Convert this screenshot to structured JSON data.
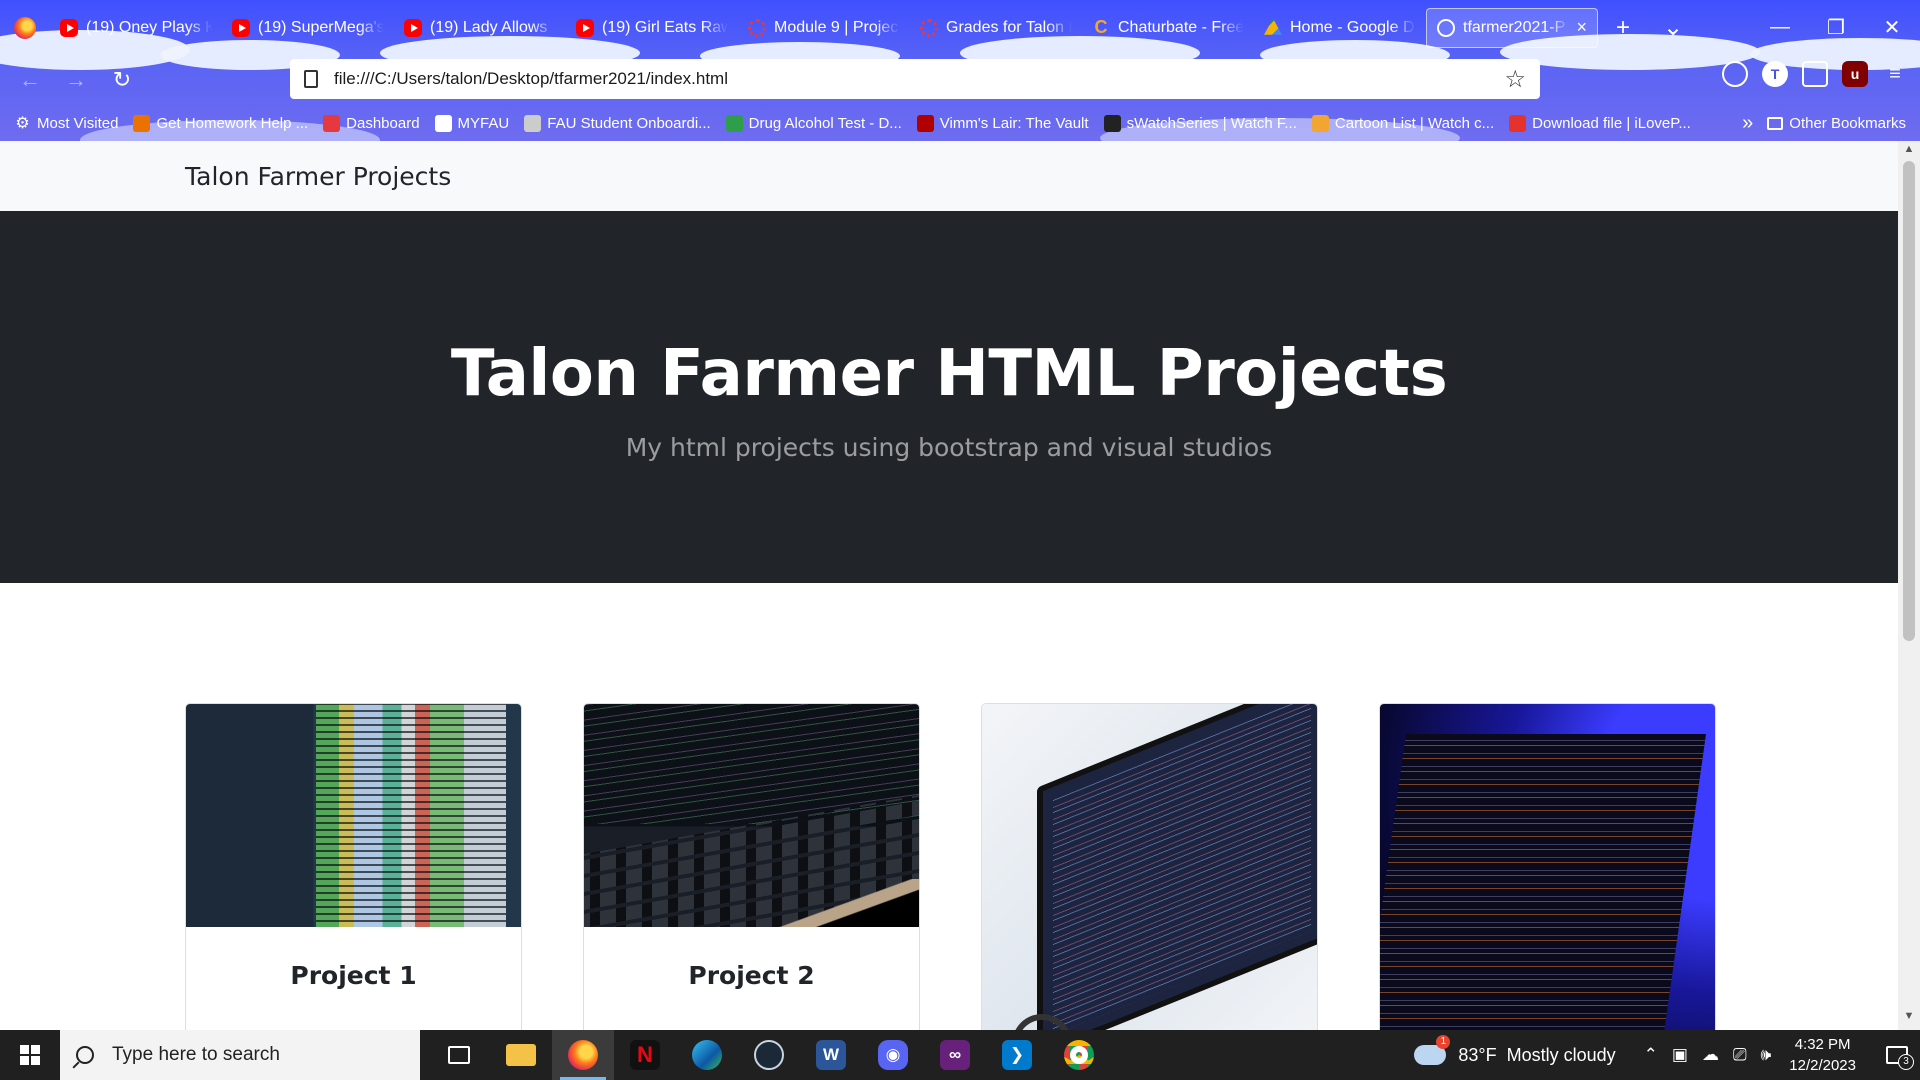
{
  "browser": {
    "tabs": [
      {
        "label": "(19) Oney Plays K",
        "icon": "youtube-icon",
        "kind": "yt"
      },
      {
        "label": "(19) SuperMega's",
        "icon": "youtube-icon",
        "kind": "yt"
      },
      {
        "label": "(19) Lady Allows",
        "icon": "youtube-icon",
        "kind": "yt"
      },
      {
        "label": "(19) Girl Eats Raw",
        "icon": "youtube-icon",
        "kind": "yt"
      },
      {
        "label": "Module 9 | Projec",
        "icon": "canvas-icon",
        "kind": "ring"
      },
      {
        "label": "Grades for Talon F",
        "icon": "canvas-icon",
        "kind": "ring"
      },
      {
        "label": "Chaturbate - Free",
        "icon": "chaturbate-icon",
        "kind": "cb"
      },
      {
        "label": "Home - Google D",
        "icon": "google-drive-icon",
        "kind": "gd"
      },
      {
        "label": "tfarmer2021-P",
        "icon": "globe-icon",
        "kind": "globe",
        "active": true
      }
    ],
    "new_tab_symbol": "+",
    "list_tabs_symbol": "⌄",
    "window_controls": {
      "minimize": "—",
      "maximize": "❐",
      "close": "✕"
    },
    "url": "file:///C:/Users/talon/Desktop/tfarmer2021/index.html",
    "bookmarks": [
      {
        "label": "Most Visited",
        "icon": "gear-icon",
        "color": "#ffffff"
      },
      {
        "label": "Get Homework Help ...",
        "icon": "chegg-icon",
        "color": "#eb7100"
      },
      {
        "label": "Dashboard",
        "icon": "canvas-icon",
        "color": "#e5393f"
      },
      {
        "label": "MYFAU",
        "icon": "myfau-icon",
        "color": "#ffffff"
      },
      {
        "label": "FAU Student Onboardi...",
        "icon": "fau-icon",
        "color": "#cccccc"
      },
      {
        "label": "Drug Alcohol Test - D...",
        "icon": "flag-icon",
        "color": "#2e9e4a"
      },
      {
        "label": "Vimm's Lair: The Vault",
        "icon": "vimm-icon",
        "color": "#b00000"
      },
      {
        "label": "sWatchSeries | Watch F...",
        "icon": "swatch-icon",
        "color": "#222222"
      },
      {
        "label": "Cartoon List | Watch c...",
        "icon": "cartoon-icon",
        "color": "#f2a531"
      },
      {
        "label": "Download file | iLoveP...",
        "icon": "ilovepdf-icon",
        "color": "#e5322d"
      }
    ],
    "bookmarks_overflow": "»",
    "other_bookmarks": "Other Bookmarks"
  },
  "page": {
    "brand": "Talon Farmer Projects",
    "hero_title": "Talon Farmer HTML Projects",
    "hero_subtitle": "My html projects using bootstrap and visual studios",
    "cards": [
      {
        "title": "Project 1",
        "image": "code-editor-image"
      },
      {
        "title": "Project 2",
        "image": "laptop-code-image"
      },
      {
        "title": "",
        "image": "monitor-code-image"
      },
      {
        "title": "",
        "image": "blue-screen-code-image"
      }
    ]
  },
  "taskbar": {
    "search_placeholder": "Type here to search",
    "apps": [
      "task-view-icon",
      "file-explorer-icon",
      "firefox-icon",
      "netflix-icon",
      "edge-icon",
      "steam-icon",
      "word-icon",
      "discord-icon",
      "visual-studio-icon",
      "vscode-icon",
      "chrome-icon"
    ],
    "weather_temp": "83°F",
    "weather_desc": "Mostly cloudy",
    "time": "4:32 PM",
    "date": "12/2/2023",
    "notification_count": "3"
  }
}
